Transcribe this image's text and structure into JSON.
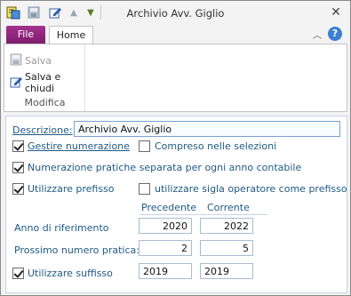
{
  "window": {
    "title": "Archivio Avv. Giglio",
    "qat_icons": [
      "app-icon",
      "save-icon",
      "edit-icon",
      "up-arrow-icon",
      "down-arrow-icon"
    ],
    "close_icon": "close-icon"
  },
  "ribbon": {
    "tabs": {
      "file": "File",
      "home": "Home"
    },
    "group": {
      "label": "Modifica",
      "save": "Salva",
      "save_close": "Salva e chiudi"
    }
  },
  "form": {
    "descrizione_label": "Descrizione:",
    "descrizione_value": "Archivio Avv. Giglio",
    "gestire_numerazione": {
      "label": "Gestire numerazione",
      "checked": true
    },
    "compreso_selezioni": {
      "label": "Compreso nelle selezioni",
      "checked": false
    },
    "numerazione_separata": {
      "label": "Numerazione pratiche separata per ogni anno contabile",
      "checked": true
    },
    "utilizzare_prefisso": {
      "label": "Utilizzare prefisso",
      "checked": true
    },
    "sigla_operatore": {
      "label": "utilizzare sigla operatore come prefisso",
      "checked": false
    },
    "col_precedente": "Precedente",
    "col_corrente": "Corrente",
    "anno_label": "Anno di riferimento",
    "anno_precedente": "2020",
    "anno_corrente": "2022",
    "prossimo_label": "Prossimo numero pratica:",
    "prossimo_precedente": "2",
    "prossimo_corrente": "5",
    "utilizzare_suffisso": {
      "label": "Utilizzare suffisso",
      "checked": true
    },
    "suffisso_precedente": "2019",
    "suffisso_corrente": "2019"
  },
  "colors": {
    "file_tab": "#8e2580",
    "label_text": "#1e5a84",
    "help": "#3c7fd0"
  }
}
